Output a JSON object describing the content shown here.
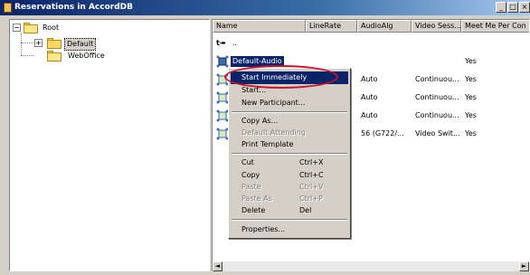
{
  "window": {
    "title": "Reservations in AccordDB",
    "min_glyph": "_",
    "max_glyph": "□",
    "close_glyph": "×"
  },
  "tree": {
    "root_label": "Root",
    "root_expander": "−",
    "items": [
      {
        "label": "Default",
        "expander": "+",
        "selected": true
      },
      {
        "label": "WebOffice"
      }
    ]
  },
  "list": {
    "columns": [
      "Name",
      "LineRate",
      "AudioAlg",
      "Video Sess...",
      "Meet Me Per Con"
    ],
    "up_row": "..",
    "rows": [
      {
        "name": "Default-Audio",
        "line_rate": "",
        "audio_alg": "",
        "video_session": "",
        "meet_me": "Yes"
      },
      {
        "name": "",
        "line_rate": "",
        "audio_alg": "Auto",
        "video_session": "Continuou...",
        "meet_me": "Yes"
      },
      {
        "name": "",
        "line_rate": "",
        "audio_alg": "Auto",
        "video_session": "Continuou...",
        "meet_me": "Yes"
      },
      {
        "name": "",
        "line_rate": "",
        "audio_alg": "Auto",
        "video_session": "Continuou...",
        "meet_me": "Yes"
      },
      {
        "name": "",
        "line_rate": "",
        "audio_alg": "56 (G722/...",
        "video_session": "Video Swit...",
        "meet_me": "Yes"
      }
    ]
  },
  "context_menu": {
    "items": [
      {
        "label": "Start Immediately",
        "highlight": true
      },
      {
        "label": "Start..."
      },
      {
        "label": "New Participant..."
      },
      {
        "separator": true
      },
      {
        "label": "Copy As..."
      },
      {
        "label": "Default Attending",
        "disabled": true
      },
      {
        "label": "Print Template"
      },
      {
        "separator": true
      },
      {
        "label": "Cut",
        "shortcut": "Ctrl+X"
      },
      {
        "label": "Copy",
        "shortcut": "Ctrl+C"
      },
      {
        "label": "Paste",
        "shortcut": "Ctrl+V",
        "disabled": true
      },
      {
        "label": "Paste As",
        "shortcut": "Ctrl+P",
        "disabled": true
      },
      {
        "label": "Delete",
        "shortcut": "Del"
      },
      {
        "separator": true
      },
      {
        "label": "Properties..."
      }
    ]
  },
  "scrollbar": {
    "left_glyph": "◄",
    "right_glyph": "►"
  },
  "colors": {
    "annotation": "#d0102a",
    "selection": "#0a246a",
    "face": "#d4d0c8"
  }
}
